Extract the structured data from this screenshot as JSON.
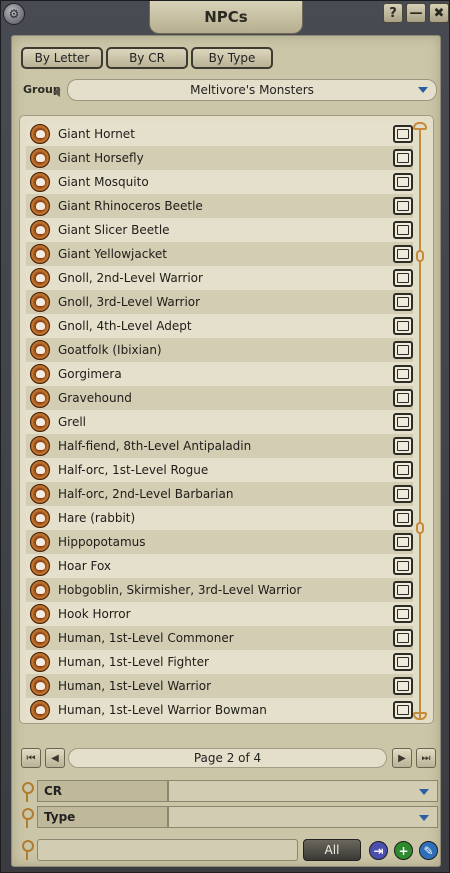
{
  "window": {
    "title": "NPCs",
    "help_label": "?",
    "minimize_label": "—",
    "close_label": "✖"
  },
  "sort_buttons": [
    "By Letter",
    "By CR",
    "By Type"
  ],
  "group": {
    "label": "Group",
    "selected": "Meltivore's Monsters"
  },
  "list": {
    "items": [
      "Giant Hornet",
      "Giant Horsefly",
      "Giant Mosquito",
      "Giant Rhinoceros Beetle",
      "Giant Slicer Beetle",
      "Giant Yellowjacket",
      "Gnoll, 2nd-Level Warrior",
      "Gnoll, 3rd-Level Warrior",
      "Gnoll, 4th-Level Adept",
      "Goatfolk (Ibixian)",
      "Gorgimera",
      "Gravehound",
      "Grell",
      "Half-fiend, 8th-Level Antipaladin",
      "Half-orc, 1st-Level Rogue",
      "Half-orc, 2nd-Level Barbarian",
      "Hare (rabbit)",
      "Hippopotamus",
      "Hoar Fox",
      "Hobgoblin, Skirmisher, 3rd-Level Warrior",
      "Hook Horror",
      "Human, 1st-Level Commoner",
      "Human, 1st-Level Fighter",
      "Human, 1st-Level Warrior",
      "Human, 1st-Level Warrior Bowman"
    ],
    "item_icon": "skull-icon",
    "open_icon": "book-icon"
  },
  "pager": {
    "text": "Page 2 of 4"
  },
  "filters": [
    {
      "label": "CR",
      "value": ""
    },
    {
      "label": "Type",
      "value": ""
    }
  ],
  "search": {
    "value": "",
    "all_label": "All"
  },
  "colors": {
    "accent_blue": "#2a5fa3",
    "add_green": "#2d8a2d",
    "edit_blue": "#2f6fb8",
    "import_purple": "#4b4fb0",
    "scroll_orange": "#c58a3a"
  }
}
